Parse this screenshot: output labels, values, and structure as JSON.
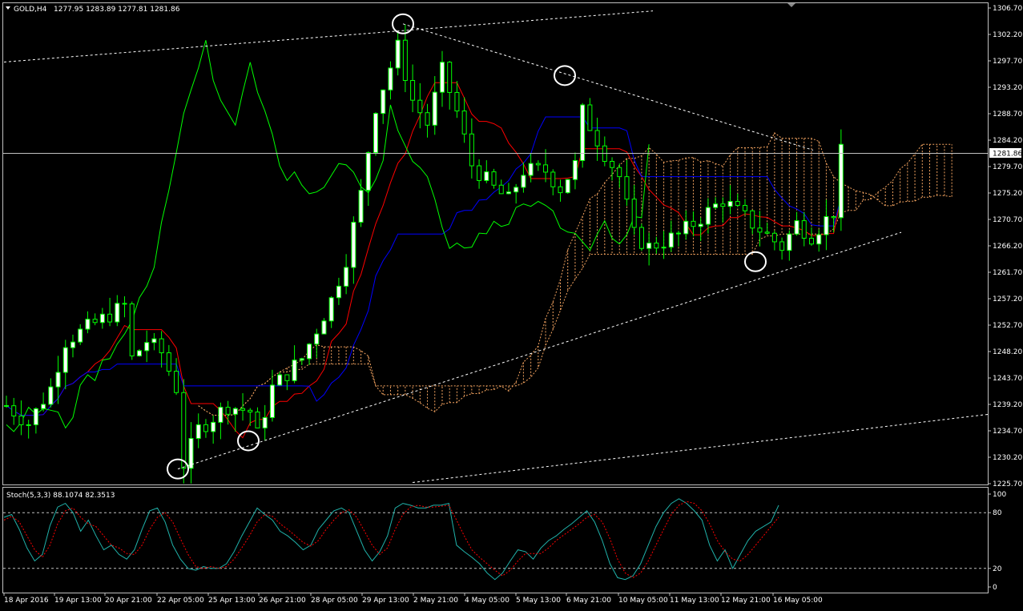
{
  "main_header": {
    "symbol": "GOLD,H4",
    "ohlc": "1277.95 1283.89 1277.81 1281.86"
  },
  "price_tag": "1281.86",
  "sub_header": "Stoch(5,3,3) 88.1074 82.3513",
  "colors": {
    "background": "#000000",
    "grid_frame": "#c0c0c0",
    "bull_candle": "#ffffff",
    "bear_candle": "#000000",
    "candle_wick": "#00ff00",
    "tenkan": "#ff0000",
    "kijun": "#0000ff",
    "chikou": "#00ff00",
    "cloud": "#f4a460",
    "stoch_main": "#20b2aa",
    "stoch_signal": "#ff0000",
    "trendline": "#ffffff"
  },
  "chart_data": [
    {
      "type": "candlestick",
      "title": "GOLD,H4",
      "indicators": [
        "Ichimoku Kinko Hyo",
        "Trend lines"
      ],
      "y_ticks": [
        "1306.70",
        "1302.20",
        "1297.70",
        "1293.20",
        "1288.70",
        "1284.20",
        "1279.70",
        "1275.20",
        "1270.70",
        "1266.20",
        "1261.70",
        "1257.20",
        "1252.70",
        "1248.20",
        "1243.70",
        "1239.20",
        "1234.70",
        "1230.20",
        "1225.70"
      ],
      "ylim": [
        1225.7,
        1306.7
      ],
      "x_ticks": [
        "18 Apr 2016",
        "19 Apr 13:00",
        "20 Apr 21:00",
        "22 Apr 05:00",
        "25 Apr 13:00",
        "26 Apr 21:00",
        "28 Apr 05:00",
        "29 Apr 13:00",
        "2 May 21:00",
        "4 May 05:00",
        "5 May 13:00",
        "6 May 21:00",
        "10 May 05:00",
        "11 May 13:00",
        "12 May 21:00",
        "16 May 05:00"
      ],
      "last_price": 1281.86,
      "pivot_markers": [
        {
          "time": "22 Apr 05:00",
          "price": 1228.2
        },
        {
          "time": "25 Apr 13:00",
          "price": 1233.0
        },
        {
          "time": "29 Apr 13:00",
          "price": 1304.0
        },
        {
          "time": "5 May 13:00",
          "price": 1295.2
        },
        {
          "time": "12 May 21:00",
          "price": 1263.5
        }
      ]
    },
    {
      "type": "line",
      "title": "Stoch(5,3,3) 88.1074 82.3513",
      "y_ticks": [
        "100",
        "80",
        "20",
        "0"
      ],
      "levels": [
        80,
        20
      ],
      "ylim": [
        0,
        100
      ],
      "series": [
        {
          "values": [
            75,
            78,
            62,
            42,
            28,
            35,
            66,
            86,
            90,
            80,
            60,
            72,
            55,
            40,
            45,
            35,
            30,
            40,
            62,
            82,
            85,
            70,
            45,
            30,
            20,
            18,
            22,
            20,
            20,
            25,
            38,
            55,
            70,
            85,
            78,
            72,
            60,
            55,
            48,
            40,
            45,
            62,
            72,
            82,
            85,
            80,
            60,
            40,
            28,
            38,
            55,
            85,
            90,
            88,
            85,
            85,
            88,
            88,
            90,
            45,
            38,
            32,
            25,
            15,
            8,
            15,
            28,
            40,
            38,
            30,
            42,
            50,
            55,
            62,
            68,
            75,
            82,
            70,
            50,
            25,
            10,
            8,
            12,
            25,
            45,
            65,
            80,
            90,
            95,
            90,
            82,
            72,
            45,
            28,
            40,
            20,
            35,
            50,
            60,
            65,
            70,
            88
          ]
        },
        {
          "values": [
            72,
            76,
            70,
            55,
            40,
            32,
            45,
            68,
            82,
            85,
            75,
            68,
            65,
            55,
            45,
            42,
            36,
            35,
            45,
            62,
            75,
            80,
            70,
            52,
            35,
            22,
            20,
            22,
            20,
            22,
            30,
            42,
            55,
            70,
            78,
            76,
            68,
            62,
            55,
            48,
            44,
            50,
            62,
            72,
            80,
            83,
            75,
            60,
            45,
            35,
            42,
            62,
            78,
            86,
            88,
            86,
            86,
            87,
            88,
            72,
            55,
            40,
            32,
            25,
            18,
            12,
            18,
            28,
            36,
            36,
            36,
            42,
            50,
            56,
            62,
            68,
            75,
            78,
            70,
            52,
            30,
            15,
            10,
            15,
            28,
            45,
            62,
            78,
            88,
            92,
            90,
            82,
            68,
            50,
            38,
            30,
            28,
            35,
            45,
            55,
            65,
            75
          ]
        }
      ]
    }
  ]
}
